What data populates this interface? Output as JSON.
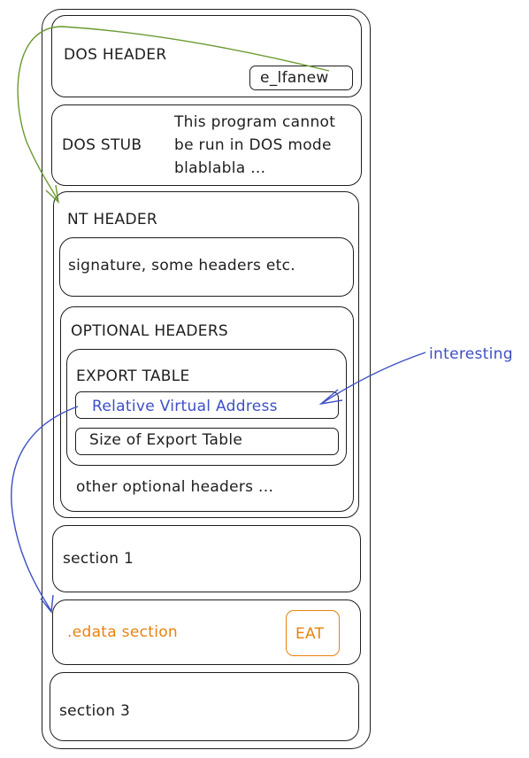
{
  "dos_header": {
    "label": "DOS HEADER",
    "field": "e_lfanew"
  },
  "dos_stub": {
    "label": "DOS STUB",
    "text_lines": [
      "This program cannot",
      "be run in DOS mode",
      "blablabla ..."
    ]
  },
  "nt_header": {
    "label": "NT HEADER",
    "signature": "signature, some headers etc.",
    "optional_headers": {
      "label": "OPTIONAL HEADERS",
      "export_table": {
        "label": "EXPORT TABLE",
        "rva": "Relative Virtual Address",
        "size": "Size of Export Table"
      },
      "other": "other optional headers ..."
    }
  },
  "sections": {
    "section1": "section 1",
    "edata": "edata section",
    "eat": "EAT",
    "section3": "section 3"
  },
  "annotation": "interesting",
  "colors": {
    "ink": "#1e1e1e",
    "green": "#6a9a2f",
    "blue": "#3d4fc4",
    "orange": "#e8820c"
  }
}
